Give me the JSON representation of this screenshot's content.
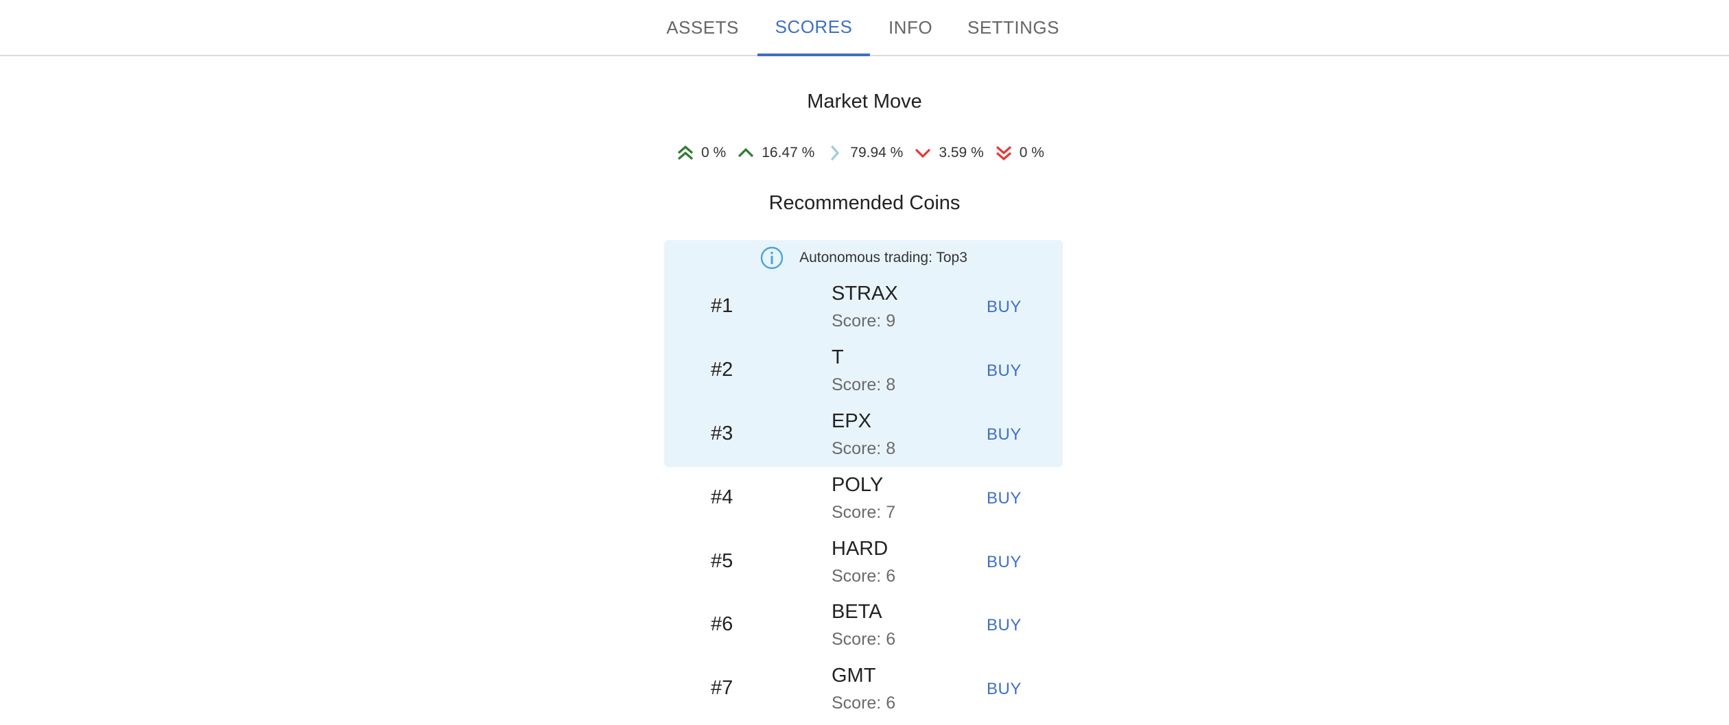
{
  "tabs": [
    {
      "label": "ASSETS"
    },
    {
      "label": "SCORES"
    },
    {
      "label": "INFO"
    },
    {
      "label": "SETTINGS"
    }
  ],
  "active_tab": "SCORES",
  "market_move": {
    "title": "Market Move",
    "items": [
      {
        "icon": "double-chevron-up-icon",
        "color": "#2e7d32",
        "value": "0 %"
      },
      {
        "icon": "chevron-up-icon",
        "color": "#2e7d32",
        "value": "16.47 %"
      },
      {
        "icon": "chevron-right-icon",
        "color": "#9fcbe8",
        "value": "79.94 %"
      },
      {
        "icon": "chevron-down-icon",
        "color": "#e53935",
        "value": "3.59 %"
      },
      {
        "icon": "double-chevron-down-icon",
        "color": "#e53935",
        "value": "0 %"
      }
    ]
  },
  "recommended": {
    "title": "Recommended Coins",
    "info_text": "Autonomous trading: Top3",
    "buy_label": "BUY",
    "coins": [
      {
        "rank": "#1",
        "name": "STRAX",
        "score": "Score: 9"
      },
      {
        "rank": "#2",
        "name": "T",
        "score": "Score: 8"
      },
      {
        "rank": "#3",
        "name": "EPX",
        "score": "Score: 8"
      },
      {
        "rank": "#4",
        "name": "POLY",
        "score": "Score: 7"
      },
      {
        "rank": "#5",
        "name": "HARD",
        "score": "Score: 6"
      },
      {
        "rank": "#6",
        "name": "BETA",
        "score": "Score: 6"
      },
      {
        "rank": "#7",
        "name": "GMT",
        "score": "Score: 6"
      }
    ]
  },
  "colors": {
    "accent": "#3f6fc4",
    "highlight_bg": "#e8f4fc",
    "info_icon": "#4aa3df"
  }
}
